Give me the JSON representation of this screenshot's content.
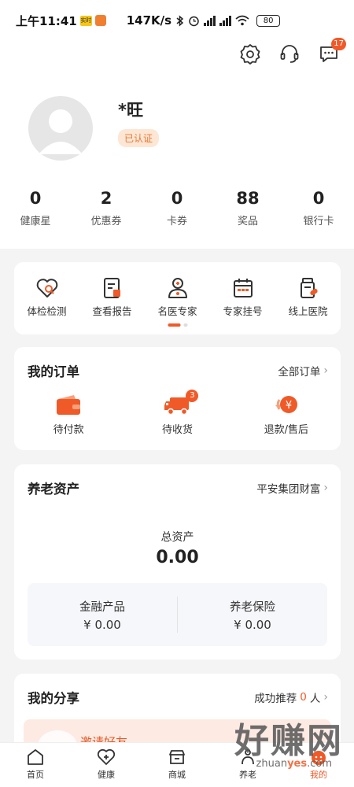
{
  "status_bar": {
    "time": "上午11:41",
    "badge_text": "实时",
    "speed": "147K/s",
    "battery": "80"
  },
  "profile": {
    "name": "*旺",
    "verified_label": "已认证"
  },
  "header": {
    "message_count": "17"
  },
  "stats": [
    {
      "value": "0",
      "label": "健康星"
    },
    {
      "value": "2",
      "label": "优惠券"
    },
    {
      "value": "0",
      "label": "卡券"
    },
    {
      "value": "88",
      "label": "奖品"
    },
    {
      "value": "0",
      "label": "银行卡"
    }
  ],
  "quick_services": [
    {
      "label": "体检检测",
      "icon": "heart-check-icon"
    },
    {
      "label": "查看报告",
      "icon": "report-icon"
    },
    {
      "label": "名医专家",
      "icon": "doctor-icon"
    },
    {
      "label": "专家挂号",
      "icon": "calendar-icon"
    },
    {
      "label": "线上医院",
      "icon": "medicine-bottle-icon"
    }
  ],
  "orders": {
    "title": "我的订单",
    "all_link": "全部订单",
    "items": [
      {
        "label": "待付款",
        "icon": "wallet-icon"
      },
      {
        "label": "待收货",
        "icon": "truck-icon",
        "badge": "3"
      },
      {
        "label": "退款/售后",
        "icon": "refund-icon"
      }
    ]
  },
  "assets": {
    "title": "养老资产",
    "link": "平安集团财富",
    "total_label": "总资产",
    "total_value": "0.00",
    "items": [
      {
        "label": "金融产品",
        "value": "¥ 0.00"
      },
      {
        "label": "养老保险",
        "value": "¥ 0.00"
      }
    ]
  },
  "share": {
    "title": "我的分享",
    "link_prefix": "成功推荐",
    "link_count": "0",
    "link_suffix": "人",
    "invite_text": "邀请好友"
  },
  "tabbar": [
    {
      "label": "首页",
      "icon": "home-icon"
    },
    {
      "label": "健康",
      "icon": "health-heart-icon"
    },
    {
      "label": "商城",
      "icon": "shop-icon"
    },
    {
      "label": "养老",
      "icon": "elderly-icon"
    },
    {
      "label": "我的",
      "icon": "user-icon"
    }
  ],
  "watermark": {
    "big": "好赚网",
    "small_a": "zhuan",
    "small_b": "yes",
    "small_c": ".com"
  },
  "colors": {
    "accent": "#f05a28",
    "accent_light": "#fde7d4"
  }
}
